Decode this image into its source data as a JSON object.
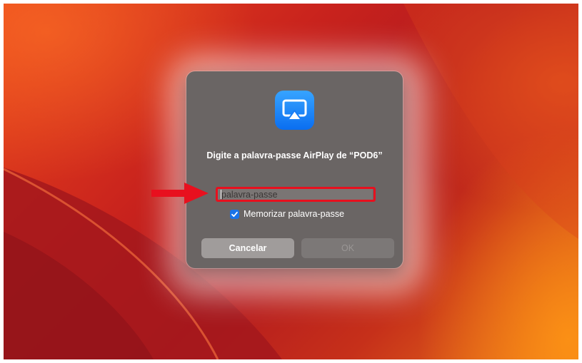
{
  "dialog": {
    "title": "Digite a palavra-passe AirPlay de “POD6”",
    "icon": "airplay-icon",
    "password_field": {
      "value": "",
      "placeholder": "palavra-passe"
    },
    "remember": {
      "label": "Memorizar palavra-passe",
      "checked": true
    },
    "buttons": {
      "cancel": "Cancelar",
      "ok": "OK"
    }
  },
  "annotation": {
    "highlight_color": "#e8101e",
    "arrow_icon": "red-arrow-icon"
  },
  "colors": {
    "accent": "#1a73e8",
    "dialog_background": "#6a6564"
  }
}
